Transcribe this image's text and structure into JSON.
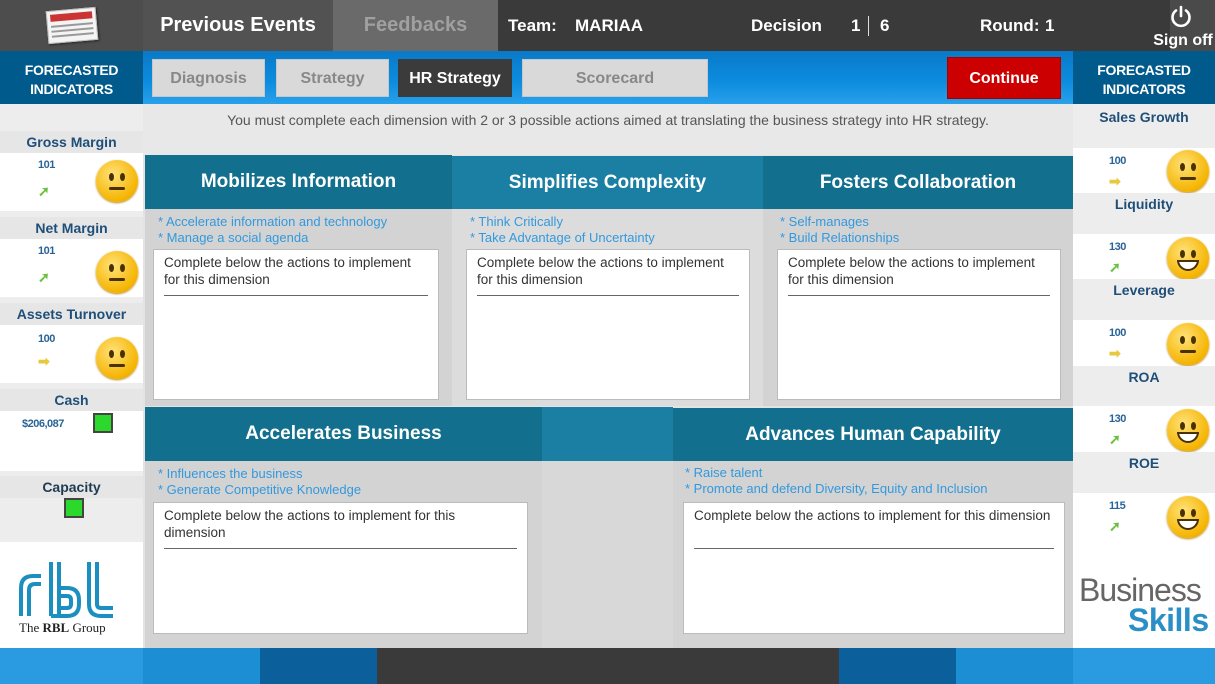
{
  "header": {
    "nav": {
      "previous_events": "Previous Events",
      "feedbacks": "Feedbacks"
    },
    "team_label": "Team:",
    "team_name": "MARIAA",
    "decision_label": "Decision",
    "decision_current": "1",
    "decision_total": "6",
    "round_label": "Round:",
    "round_value": "1",
    "sign_off": "Sign off"
  },
  "tabs": [
    "Diagnosis",
    "Strategy",
    "HR Strategy",
    "Scorecard"
  ],
  "active_tab": "HR Strategy",
  "continue_label": "Continue",
  "instructions": "You must complete each dimension with 2 or 3 possible actions aimed at translating the business strategy into HR strategy.",
  "left_panel": {
    "title": "FORECASTED INDICATORS",
    "indicators": [
      {
        "label": "Gross Margin",
        "value": "101",
        "trend": "up",
        "mood": "neutral"
      },
      {
        "label": "Net Margin",
        "value": "101",
        "trend": "up",
        "mood": "neutral"
      },
      {
        "label": "Assets Turnover",
        "value": "100",
        "trend": "flat",
        "mood": "neutral"
      }
    ],
    "cash": {
      "label": "Cash",
      "value": "$206,087",
      "status_color": "#2bd82b"
    },
    "capacity": {
      "label": "Capacity",
      "status_color": "#2bd82b"
    }
  },
  "right_panel": {
    "title": "FORECASTED INDICATORS",
    "indicators": [
      {
        "label": "Sales Growth",
        "value": "100",
        "trend": "flat",
        "mood": "neutral"
      },
      {
        "label": "Liquidity",
        "value": "130",
        "trend": "up",
        "mood": "happy"
      },
      {
        "label": "Leverage",
        "value": "100",
        "trend": "flat",
        "mood": "neutral"
      },
      {
        "label": "ROA",
        "value": "130",
        "trend": "up",
        "mood": "happy"
      },
      {
        "label": "ROE",
        "value": "115",
        "trend": "up",
        "mood": "happy"
      }
    ]
  },
  "dimensions": [
    {
      "title": "Mobilizes Information",
      "hints": [
        "* Accelerate information and technology",
        "* Manage a social agenda"
      ],
      "box_text": "Complete below the actions to implement for this dimension"
    },
    {
      "title": "Simplifies Complexity",
      "hints": [
        "* Think Critically",
        "* Take Advantage of Uncertainty"
      ],
      "box_text": "Complete below the actions to implement for this dimension"
    },
    {
      "title": "Fosters Collaboration",
      "hints": [
        "* Self-manages",
        "* Build Relationships"
      ],
      "box_text": "Complete below the actions to implement for this dimension"
    },
    {
      "title": "Accelerates Business",
      "hints": [
        "* Influences the business",
        "* Generate Competitive Knowledge"
      ],
      "box_text": "Complete below the actions to implement for this dimension"
    },
    {
      "title": "Advances Human Capability",
      "hints": [
        "* Raise talent",
        "* Promote and defend Diversity, Equity and Inclusion"
      ],
      "box_text": "Complete below the actions to implement for this dimension"
    }
  ],
  "logos": {
    "rbl_mark": "rbl",
    "rbl_caption_pre": "The ",
    "rbl_caption_bold": "RBL",
    "rbl_caption_post": " Group",
    "business": "Business",
    "skills": "Skills"
  },
  "colors": {
    "accent_blue": "#0a79c8",
    "dimension_teal": "#13708f",
    "continue_red": "#cc0000",
    "hint_blue": "#3399dd"
  }
}
